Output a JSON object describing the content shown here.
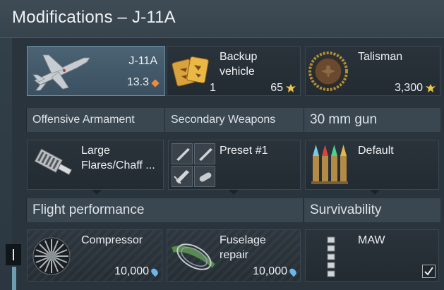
{
  "window": {
    "title": "Modifications – J-11A"
  },
  "vehicles": [
    {
      "name": "J-11A",
      "value": "13.3",
      "value_icon": "rank-diamond-icon",
      "selected": true
    },
    {
      "name": "Backup vehicle",
      "count": "1",
      "cost": "65",
      "cost_icon": "golden-eagle-icon"
    },
    {
      "name": "Talisman",
      "cost": "3,300",
      "cost_icon": "golden-eagle-icon"
    }
  ],
  "columns": {
    "offensive": "Offensive Armament",
    "secondary": "Secondary Weapons",
    "gun": "30 mm gun",
    "flight": "Flight performance",
    "survivability": "Survivability"
  },
  "weapons": {
    "offensive": {
      "name": "Large Flares/Chaff ..."
    },
    "secondary": {
      "name": "Preset #1"
    },
    "gun": {
      "name": "Default"
    }
  },
  "modifications": [
    {
      "name": "Compressor",
      "cost": "10,000",
      "cost_icon": "research-point-icon"
    },
    {
      "name": "Fuselage repair",
      "cost": "10,000",
      "cost_icon": "research-point-icon"
    },
    {
      "name": "MAW",
      "checked": true
    }
  ],
  "colors": {
    "accent_orange": "#f08a3c",
    "gold": "#e9c44b",
    "research_blue": "#6bb6e8"
  }
}
